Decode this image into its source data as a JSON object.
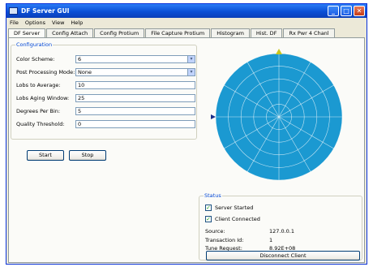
{
  "window": {
    "title": "DF Server GUI",
    "min": "_",
    "max": "□",
    "close": "✕"
  },
  "menu": [
    "File",
    "Options",
    "View",
    "Help"
  ],
  "tabs": [
    "DF Server",
    "Config Attach",
    "Config Protium",
    "File Capture Protium",
    "Histogram",
    "Hist. DF",
    "Rx Pwr 4 Chanl"
  ],
  "config": {
    "title": "Configuration",
    "color_scheme": {
      "label": "Color Scheme:",
      "value": "6"
    },
    "post_processing": {
      "label": "Post Processing Mode:",
      "value": "None"
    },
    "lobs_average": {
      "label": "Lobs to Average:",
      "value": "10"
    },
    "lobs_aging": {
      "label": "Lobs Aging Window:",
      "value": "25"
    },
    "degrees_per_bin": {
      "label": "Degrees Per Bin:",
      "value": "5"
    },
    "quality_threshold": {
      "label": "Quality Threshold:",
      "value": "0"
    }
  },
  "buttons": {
    "start": "Start",
    "stop": "Stop",
    "disconnect": "Disconnect Client"
  },
  "status": {
    "title": "Status",
    "server_started": {
      "label": "Server Started",
      "checked": true
    },
    "client_connected": {
      "label": "Client Connected",
      "checked": true
    },
    "source": {
      "label": "Source:",
      "value": "127.0.0.1"
    },
    "transaction_id": {
      "label": "Transaction Id:",
      "value": "1"
    },
    "tune_request": {
      "label": "Tune Request:",
      "value": "8.92E+08"
    }
  },
  "polar": {
    "fill": "#1b99d1",
    "north_marker": "#c9c51e",
    "west_marker": "#1a2f8a"
  },
  "icons": {
    "dropdown": "▾",
    "check": "✓"
  }
}
